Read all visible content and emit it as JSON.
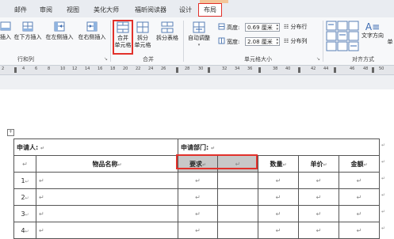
{
  "tabs": [
    "邮件",
    "审阅",
    "视图",
    "美化大师",
    "福昕阅读器",
    "设计",
    "布局"
  ],
  "ribbon": {
    "insert_below": "插入",
    "insert_above_left": "在下方插入",
    "insert_left": "在左侧插入",
    "insert_right": "在右侧插入",
    "merge": "合并\n单元格",
    "split_cells": "拆分\n单元格",
    "split_table": "拆分表格",
    "autofit": "自动调整",
    "height_label": "高度:",
    "height_value": "0.69 厘米",
    "width_label": "宽度:",
    "width_value": "2.08 厘米",
    "distribute_rows": "分布行",
    "distribute_cols": "分布列",
    "text_direction": "文字方向",
    "cell_margin": "单",
    "group_rows_cols": "行和列",
    "group_merge": "合并",
    "group_cell_size": "单元格大小",
    "group_align": "对齐方式"
  },
  "ruler": [
    "2",
    "2",
    "4",
    "6",
    "8",
    "10",
    "12",
    "14",
    "16",
    "18",
    "20",
    "22",
    "24",
    "26",
    "28",
    "30",
    "32",
    "34",
    "36",
    "38",
    "40",
    "42",
    "44",
    "46",
    "48",
    "50",
    "52"
  ],
  "table": {
    "applicant": "申请人:",
    "department": "申请部门:",
    "item_name": "物品名称",
    "requirement": "要求",
    "quantity": "数量",
    "unit_price": "单价",
    "amount": "金额",
    "rows": [
      "1",
      "2",
      "3",
      "4"
    ]
  },
  "marks": {
    "para": "↵",
    "anchor": "+"
  },
  "colors": {
    "highlight": "#e2312b",
    "selection": "#c8c8c8"
  }
}
